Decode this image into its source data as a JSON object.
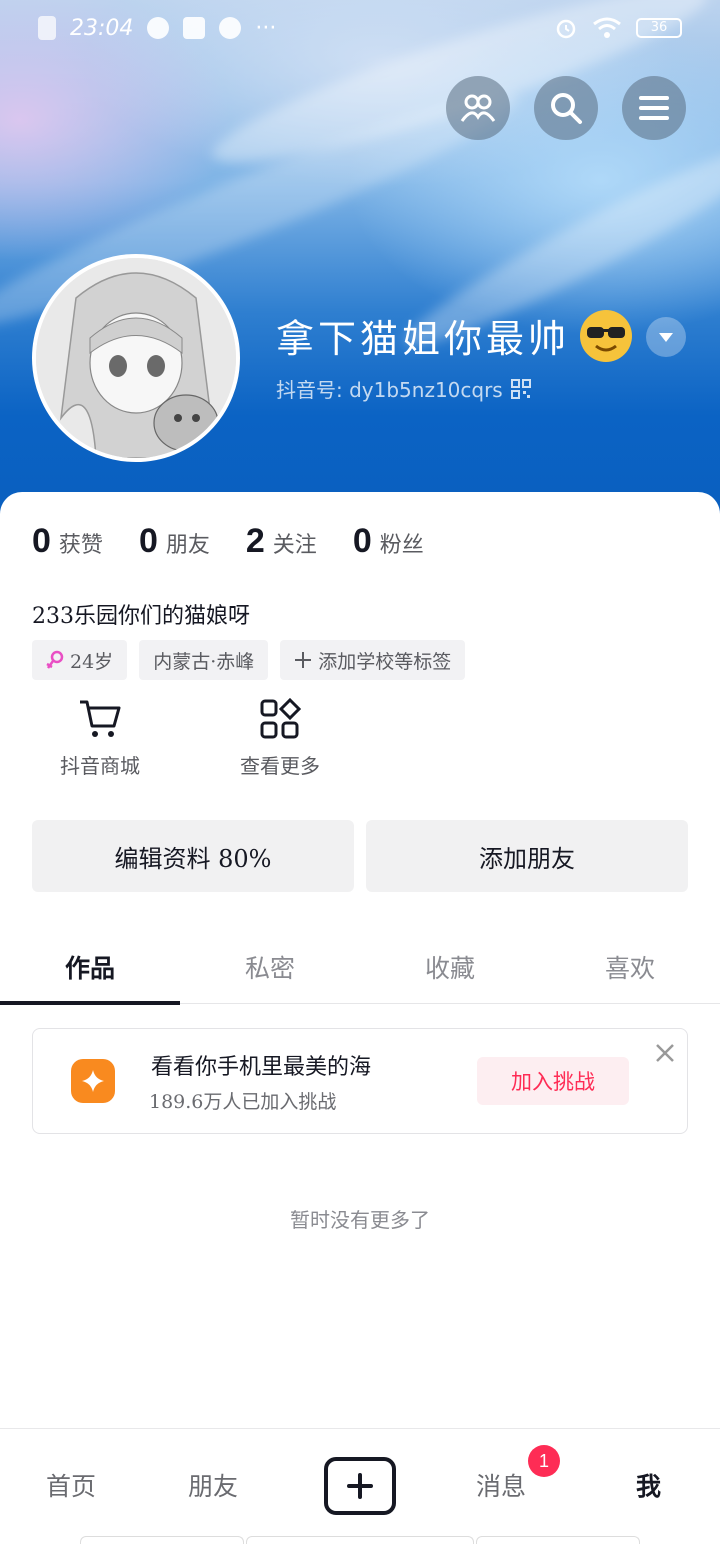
{
  "status_bar": {
    "time": "23:04",
    "battery": "36"
  },
  "header": {
    "nickname": "拿下猫姐你最帅",
    "douyin_id": "抖音号: dy1b5nz10cqrs"
  },
  "stats": [
    {
      "value": "0",
      "label": "获赞"
    },
    {
      "value": "0",
      "label": "朋友"
    },
    {
      "value": "2",
      "label": "关注"
    },
    {
      "value": "0",
      "label": "粉丝"
    }
  ],
  "bio": "233乐园你们的猫娘呀",
  "tags": {
    "gender_age": "24岁",
    "location": "内蒙古·赤峰",
    "add_school": "添加学校等标签"
  },
  "tools": [
    {
      "label": "抖音商城",
      "icon": "cart-icon"
    },
    {
      "label": "查看更多",
      "icon": "grid-icon"
    }
  ],
  "actions": {
    "edit_profile": "编辑资料 80%",
    "add_friend": "添加朋友"
  },
  "tabs": [
    "作品",
    "私密",
    "收藏",
    "喜欢"
  ],
  "challenge": {
    "title": "看看你手机里最美的海",
    "subtitle": "189.6万人已加入挑战",
    "button": "加入挑战"
  },
  "empty_text": "暂时没有更多了",
  "bottom_nav": {
    "home": "首页",
    "friends": "朋友",
    "messages": "消息",
    "me": "我",
    "message_badge": "1"
  },
  "colors": {
    "accent": "#fe2c55",
    "challenge_icon": "#f98a1f",
    "header_blue": "#0b63c4"
  }
}
